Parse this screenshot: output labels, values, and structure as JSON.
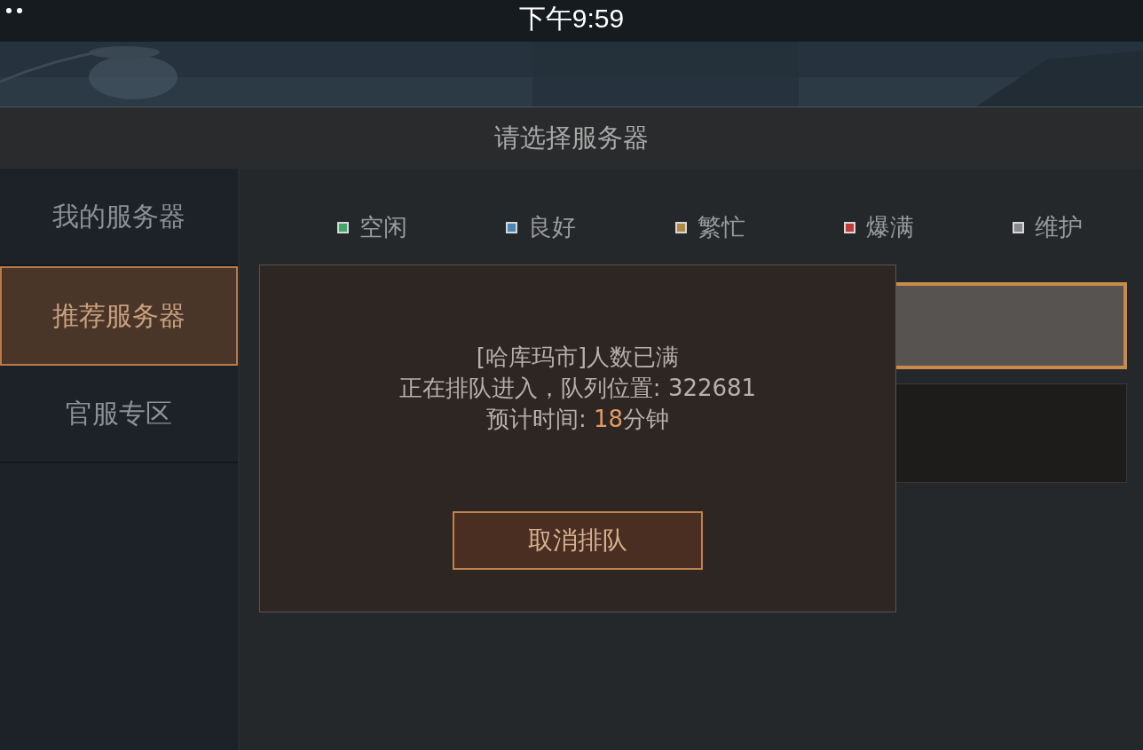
{
  "status_bar": {
    "time": "下午9:59"
  },
  "header": {
    "title": "请选择服务器"
  },
  "sidebar": {
    "items": [
      {
        "label": "我的服务器",
        "selected": false
      },
      {
        "label": "推荐服务器",
        "selected": true
      },
      {
        "label": "官服专区",
        "selected": false
      }
    ]
  },
  "legend": [
    {
      "label": "空闲",
      "color": "#3fa868"
    },
    {
      "label": "良好",
      "color": "#4a86b8"
    },
    {
      "label": "繁忙",
      "color": "#b08a45"
    },
    {
      "label": "爆满",
      "color": "#c03a3a"
    },
    {
      "label": "维护",
      "color": "#8a8a8a"
    }
  ],
  "server_cards": [
    {
      "selected": true
    },
    {
      "selected": false
    }
  ],
  "dialog": {
    "lines": [
      {
        "text": "[哈库玛市]人数已满"
      },
      {
        "text": "正在排队进入，队列位置: 322681"
      },
      {
        "text": "预计时间: ",
        "highlight": "18",
        "after": "分钟"
      }
    ],
    "button": "取消排队"
  }
}
